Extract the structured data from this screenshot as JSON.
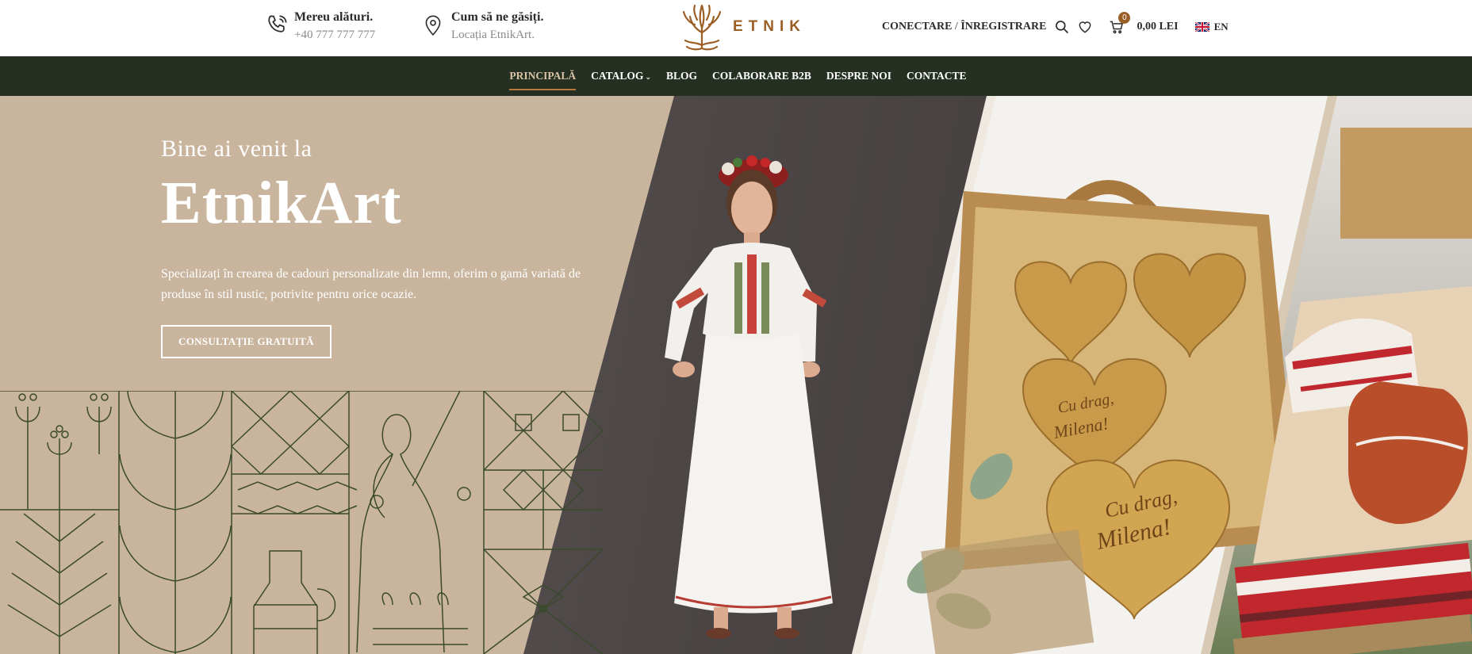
{
  "header": {
    "phone": {
      "title": "Mereu alături.",
      "value": "+40 777 777 777",
      "icon": "phone-icon"
    },
    "location": {
      "title": "Cum să ne găsiți.",
      "value": "Locația EtnikArt.",
      "icon": "map-pin-icon"
    },
    "logo_text": "ETNIK",
    "login": "CONECTARE",
    "login_sep": " / ",
    "register": "ÎNREGISTRARE",
    "cart_count": "0",
    "cart_total": "0,00 LEI",
    "language": "EN"
  },
  "nav": {
    "items": [
      {
        "label": "PRINCIPALĂ",
        "active": true
      },
      {
        "label": "CATALOG",
        "dropdown": true
      },
      {
        "label": "BLOG"
      },
      {
        "label": "COLABORARE B2B"
      },
      {
        "label": "DESPRE NOI"
      },
      {
        "label": "CONTACTE"
      }
    ],
    "dropdown_glyph": "⌄"
  },
  "hero": {
    "subtitle": "Bine ai venit la",
    "title": "EtnikArt",
    "description": "Specializați în crearea de cadouri personalizate din lemn, oferim o gamă variată de produse în stil rustic, potrivite pentru orice ocazie.",
    "cta": "CONSULTAȚIE GRATUITĂ",
    "heart_text_1": "Cu drag,",
    "heart_text_2": "Milena!"
  },
  "colors": {
    "nav_bg": "#263022",
    "hero_beige": "#c9b59d",
    "brand": "#9b5f25",
    "active_nav": "#d9c3a7",
    "pattern_stroke": "#3b4a2c"
  }
}
